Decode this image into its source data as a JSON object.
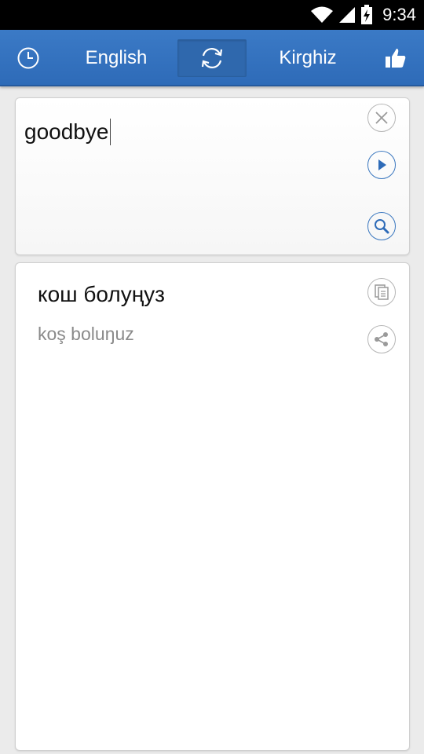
{
  "status_bar": {
    "time": "9:34",
    "icons": [
      "wifi-icon",
      "signal-icon",
      "battery-charging-icon"
    ]
  },
  "toolbar": {
    "history_icon": "clock-icon",
    "source_language": "English",
    "swap_icon": "swap-arrows-icon",
    "target_language": "Kirghiz",
    "like_icon": "thumbs-up-icon",
    "accent_color": "#3b7ac6"
  },
  "input": {
    "value": "goodbye",
    "actions": [
      "clear-icon",
      "play-icon",
      "search-icon"
    ]
  },
  "output": {
    "translation": "кош болуңуз",
    "transliteration": "koş boluŋuz",
    "actions": [
      "copy-icon",
      "share-icon"
    ]
  }
}
